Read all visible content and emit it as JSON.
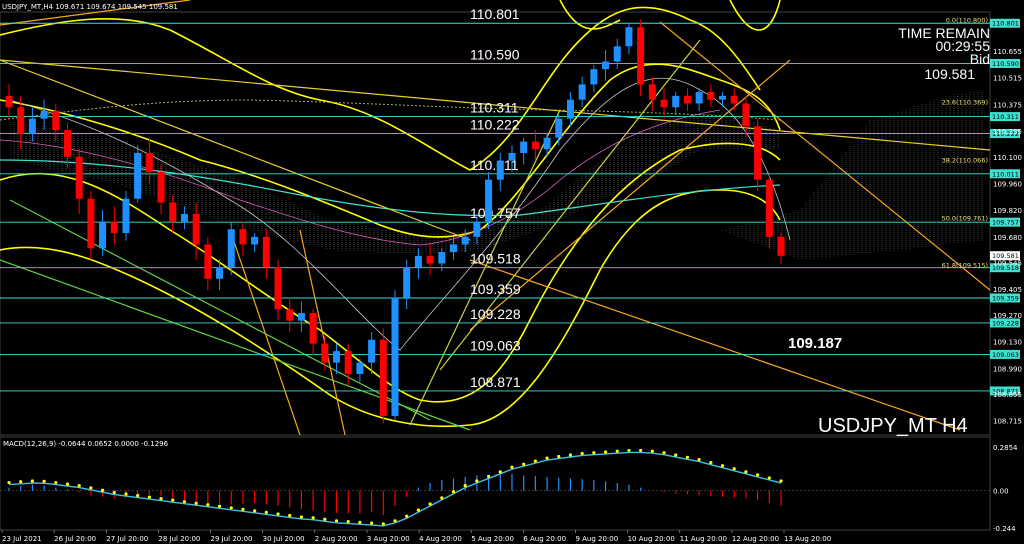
{
  "header": {
    "symbol_line": "USDJPY_MT,H4  109.671 109.674 109.545 109.581"
  },
  "info": {
    "time_remain_label": "TIME REMAIN",
    "time_remain_value": "00:29:55",
    "bid_label": "Bid",
    "bid_value": "109.581"
  },
  "watermark": "USDJPY_MT H4",
  "target_label": "109.187",
  "macd_label": "MACD(12,26,9) -0.0644 0.0652 0.0000 -0.1296",
  "colors": {
    "bull": "#1e90ff",
    "bear": "#ff0000",
    "level_line": "#40e0d0",
    "channel": "#ffff00",
    "trend": "#f5a623",
    "signal_dots": "#ffff00",
    "macd_line": "#40c0e0"
  },
  "chart_data": {
    "type": "candlestick",
    "symbol": "USDJPY_MT",
    "timeframe": "H4",
    "ylim": [
      108.64,
      110.86
    ],
    "price_axis_ticks": [
      "110.655",
      "110.515",
      "110.375",
      "110.235",
      "110.100",
      "109.960",
      "109.820",
      "109.680",
      "109.545",
      "109.405",
      "109.270",
      "109.130",
      "108.990",
      "108.855",
      "108.715"
    ],
    "x_tick_labels": [
      "23 Jul 2021",
      "26 Jul 20:00",
      "27 Jul 20:00",
      "28 Jul 20:00",
      "29 Jul 20:00",
      "30 Jul 20:00",
      "2 Aug 20:00",
      "3 Aug 20:00",
      "4 Aug 20:00",
      "5 Aug 20:00",
      "6 Aug 20:00",
      "9 Aug 20:00",
      "10 Aug 20:00",
      "11 Aug 20:00",
      "12 Aug 20:00",
      "13 Aug 20:00"
    ],
    "horizontal_levels": [
      "110.801",
      "110.590",
      "110.311",
      "110.222",
      "110.011",
      "109.757",
      "109.518",
      "109.359",
      "109.228",
      "109.063",
      "108.871"
    ],
    "fib_labels": [
      {
        "label": "0.0(110.800)",
        "price": 110.8
      },
      {
        "label": "23.6(110.369)",
        "price": 110.369
      },
      {
        "label": "38.2(110.066)",
        "price": 110.066
      },
      {
        "label": "50.0(109.761)",
        "price": 109.761
      },
      {
        "label": "61.8(109.515)",
        "price": 109.515
      }
    ],
    "right_tags": [
      "110.801",
      "110.590",
      "110.311",
      "110.222",
      "110.011",
      "109.757",
      "109.581",
      "109.518",
      "109.359",
      "109.228",
      "109.063",
      "108.871"
    ],
    "candles": [
      {
        "o": 110.42,
        "h": 110.48,
        "c": 110.36,
        "l": 110.3
      },
      {
        "o": 110.36,
        "h": 110.42,
        "c": 110.22,
        "l": 110.14
      },
      {
        "o": 110.22,
        "h": 110.36,
        "c": 110.3,
        "l": 110.18
      },
      {
        "o": 110.3,
        "h": 110.4,
        "c": 110.34,
        "l": 110.24
      },
      {
        "o": 110.34,
        "h": 110.38,
        "c": 110.24,
        "l": 110.18
      },
      {
        "o": 110.24,
        "h": 110.28,
        "c": 110.1,
        "l": 110.04
      },
      {
        "o": 110.1,
        "h": 110.14,
        "c": 109.88,
        "l": 109.8
      },
      {
        "o": 109.88,
        "h": 109.92,
        "c": 109.62,
        "l": 109.56
      },
      {
        "o": 109.62,
        "h": 109.82,
        "c": 109.76,
        "l": 109.58
      },
      {
        "o": 109.76,
        "h": 109.84,
        "c": 109.7,
        "l": 109.64
      },
      {
        "o": 109.7,
        "h": 109.92,
        "c": 109.88,
        "l": 109.66
      },
      {
        "o": 109.88,
        "h": 110.16,
        "c": 110.12,
        "l": 109.86
      },
      {
        "o": 110.12,
        "h": 110.2,
        "c": 110.02,
        "l": 109.96
      },
      {
        "o": 110.02,
        "h": 110.06,
        "c": 109.86,
        "l": 109.8
      },
      {
        "o": 109.86,
        "h": 109.9,
        "c": 109.76,
        "l": 109.7
      },
      {
        "o": 109.76,
        "h": 109.84,
        "c": 109.8,
        "l": 109.72
      },
      {
        "o": 109.8,
        "h": 109.86,
        "c": 109.64,
        "l": 109.56
      },
      {
        "o": 109.64,
        "h": 109.68,
        "c": 109.46,
        "l": 109.4
      },
      {
        "o": 109.46,
        "h": 109.56,
        "c": 109.52,
        "l": 109.4
      },
      {
        "o": 109.52,
        "h": 109.76,
        "c": 109.72,
        "l": 109.48
      },
      {
        "o": 109.72,
        "h": 109.76,
        "c": 109.64,
        "l": 109.58
      },
      {
        "o": 109.64,
        "h": 109.7,
        "c": 109.68,
        "l": 109.6
      },
      {
        "o": 109.68,
        "h": 109.72,
        "c": 109.52,
        "l": 109.46
      },
      {
        "o": 109.52,
        "h": 109.56,
        "c": 109.3,
        "l": 109.24
      },
      {
        "o": 109.3,
        "h": 109.36,
        "c": 109.24,
        "l": 109.18
      },
      {
        "o": 109.24,
        "h": 109.34,
        "c": 109.28,
        "l": 109.18
      },
      {
        "o": 109.28,
        "h": 109.3,
        "c": 109.12,
        "l": 109.06
      },
      {
        "o": 109.12,
        "h": 109.16,
        "c": 109.02,
        "l": 108.98
      },
      {
        "o": 109.02,
        "h": 109.12,
        "c": 109.08,
        "l": 108.96
      },
      {
        "o": 109.08,
        "h": 109.12,
        "c": 108.96,
        "l": 108.9
      },
      {
        "o": 108.96,
        "h": 109.04,
        "c": 109.02,
        "l": 108.92
      },
      {
        "o": 109.02,
        "h": 109.18,
        "c": 109.14,
        "l": 108.96
      },
      {
        "o": 109.14,
        "h": 109.2,
        "c": 108.74,
        "l": 108.7
      },
      {
        "o": 108.74,
        "h": 109.4,
        "c": 109.36,
        "l": 108.72
      },
      {
        "o": 109.36,
        "h": 109.56,
        "c": 109.52,
        "l": 109.3
      },
      {
        "o": 109.52,
        "h": 109.62,
        "c": 109.58,
        "l": 109.46
      },
      {
        "o": 109.58,
        "h": 109.64,
        "c": 109.54,
        "l": 109.48
      },
      {
        "o": 109.54,
        "h": 109.62,
        "c": 109.6,
        "l": 109.5
      },
      {
        "o": 109.6,
        "h": 109.68,
        "c": 109.64,
        "l": 109.56
      },
      {
        "o": 109.64,
        "h": 109.72,
        "c": 109.68,
        "l": 109.6
      },
      {
        "o": 109.68,
        "h": 109.8,
        "c": 109.76,
        "l": 109.64
      },
      {
        "o": 109.76,
        "h": 110.02,
        "c": 109.98,
        "l": 109.72
      },
      {
        "o": 109.98,
        "h": 110.12,
        "c": 110.08,
        "l": 109.92
      },
      {
        "o": 110.08,
        "h": 110.16,
        "c": 110.12,
        "l": 110.02
      },
      {
        "o": 110.12,
        "h": 110.2,
        "c": 110.18,
        "l": 110.06
      },
      {
        "o": 110.18,
        "h": 110.24,
        "c": 110.14,
        "l": 110.08
      },
      {
        "o": 110.14,
        "h": 110.22,
        "c": 110.2,
        "l": 110.1
      },
      {
        "o": 110.2,
        "h": 110.32,
        "c": 110.3,
        "l": 110.16
      },
      {
        "o": 110.3,
        "h": 110.44,
        "c": 110.4,
        "l": 110.26
      },
      {
        "o": 110.4,
        "h": 110.52,
        "c": 110.48,
        "l": 110.36
      },
      {
        "o": 110.48,
        "h": 110.58,
        "c": 110.56,
        "l": 110.44
      },
      {
        "o": 110.56,
        "h": 110.66,
        "c": 110.6,
        "l": 110.5
      },
      {
        "o": 110.6,
        "h": 110.72,
        "c": 110.68,
        "l": 110.56
      },
      {
        "o": 110.68,
        "h": 110.8,
        "c": 110.78,
        "l": 110.64
      },
      {
        "o": 110.78,
        "h": 110.82,
        "c": 110.48,
        "l": 110.42
      },
      {
        "o": 110.48,
        "h": 110.52,
        "c": 110.4,
        "l": 110.34
      },
      {
        "o": 110.4,
        "h": 110.46,
        "c": 110.36,
        "l": 110.3
      },
      {
        "o": 110.36,
        "h": 110.44,
        "c": 110.42,
        "l": 110.32
      },
      {
        "o": 110.42,
        "h": 110.46,
        "c": 110.38,
        "l": 110.34
      },
      {
        "o": 110.38,
        "h": 110.46,
        "c": 110.44,
        "l": 110.34
      },
      {
        "o": 110.44,
        "h": 110.48,
        "c": 110.4,
        "l": 110.36
      },
      {
        "o": 110.4,
        "h": 110.44,
        "c": 110.42,
        "l": 110.36
      },
      {
        "o": 110.42,
        "h": 110.46,
        "c": 110.38,
        "l": 110.34
      },
      {
        "o": 110.38,
        "h": 110.42,
        "c": 110.26,
        "l": 110.2
      },
      {
        "o": 110.26,
        "h": 110.3,
        "c": 109.98,
        "l": 109.92
      },
      {
        "o": 109.98,
        "h": 110.02,
        "c": 109.68,
        "l": 109.62
      },
      {
        "o": 109.68,
        "h": 109.7,
        "c": 109.58,
        "l": 109.54
      }
    ],
    "macd": {
      "ylim": [
        -0.244,
        0.2854
      ],
      "tick_labels": [
        "0.2854",
        "0.00",
        "-0.244"
      ],
      "histogram": [
        0.02,
        0.03,
        0.04,
        0.035,
        0.02,
        0.01,
        -0.01,
        -0.03,
        -0.04,
        -0.05,
        -0.045,
        -0.03,
        -0.025,
        -0.035,
        -0.05,
        -0.06,
        -0.07,
        -0.08,
        -0.085,
        -0.09,
        -0.085,
        -0.08,
        -0.09,
        -0.1,
        -0.11,
        -0.12,
        -0.13,
        -0.14,
        -0.145,
        -0.15,
        -0.15,
        -0.14,
        -0.16,
        -0.1,
        -0.04,
        0.02,
        0.05,
        0.07,
        0.08,
        0.09,
        0.1,
        0.1,
        0.11,
        0.11,
        0.1,
        0.095,
        0.09,
        0.085,
        0.08,
        0.075,
        0.07,
        0.06,
        0.05,
        0.04,
        0.02,
        0.0,
        -0.01,
        -0.02,
        -0.025,
        -0.03,
        -0.035,
        -0.04,
        -0.045,
        -0.05,
        -0.06,
        -0.08,
        -0.1
      ],
      "signal": [
        0.04,
        0.045,
        0.05,
        0.048,
        0.04,
        0.03,
        0.02,
        0.005,
        -0.01,
        -0.025,
        -0.035,
        -0.045,
        -0.055,
        -0.065,
        -0.075,
        -0.085,
        -0.095,
        -0.105,
        -0.115,
        -0.125,
        -0.135,
        -0.145,
        -0.155,
        -0.165,
        -0.175,
        -0.185,
        -0.19,
        -0.2,
        -0.21,
        -0.215,
        -0.22,
        -0.225,
        -0.23,
        -0.21,
        -0.18,
        -0.14,
        -0.1,
        -0.06,
        -0.02,
        0.02,
        0.05,
        0.08,
        0.11,
        0.14,
        0.16,
        0.18,
        0.2,
        0.21,
        0.22,
        0.23,
        0.235,
        0.24,
        0.245,
        0.25,
        0.25,
        0.245,
        0.235,
        0.22,
        0.205,
        0.19,
        0.17,
        0.15,
        0.13,
        0.11,
        0.09,
        0.07,
        0.05
      ]
    }
  }
}
